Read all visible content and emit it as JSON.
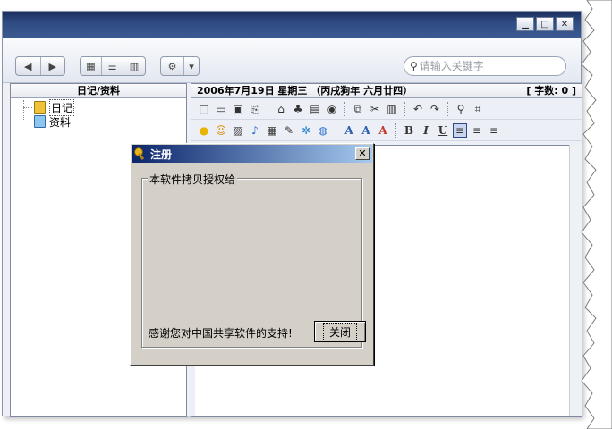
{
  "window": {
    "controls": {
      "minimize": "▁",
      "maximize": "□",
      "close": "✕"
    }
  },
  "toolbar": {
    "back_glyph": "◀",
    "forward_glyph": "▶",
    "view_grid": "▦",
    "view_list": "☰",
    "view_columns": "▥",
    "settings_glyph": "⚙",
    "settings_arrow": "▾"
  },
  "search": {
    "placeholder": "请输入关键字",
    "icon": "search-icon"
  },
  "left_pane": {
    "header": "日记/资料",
    "items": [
      {
        "label": "日记",
        "icon": "diary-icon"
      },
      {
        "label": "资料",
        "icon": "data-icon"
      }
    ]
  },
  "editor": {
    "date_text": "2006年7月19日  星期三 （丙戌狗年 六月廿四）",
    "word_count": "[ 字数: 0 ]",
    "toolbar1": [
      "□",
      "▭",
      "▣",
      "⎘",
      "⌂",
      "♣",
      "▤",
      "◉",
      "⧉",
      "✂",
      "▥",
      "↶",
      "↷",
      "⚲",
      "⌗"
    ],
    "toolbar2": [
      "●",
      "☺",
      "▨",
      "♪",
      "▦",
      "✎",
      "✲",
      "◍",
      "A",
      "A",
      "A",
      "B",
      "I",
      "U"
    ]
  },
  "dialog": {
    "title": "注册",
    "close_glyph": "✕",
    "group_label": "本软件拷贝授权给",
    "thanks": "感谢您对中国共享软件的支持!",
    "close_button": "关闭"
  },
  "colors": {
    "dialog_title_start": "#0a246a",
    "dialog_title_end": "#a6caf0",
    "window_title": "#2f4b83",
    "dialog_bg": "#d4d0c8"
  }
}
